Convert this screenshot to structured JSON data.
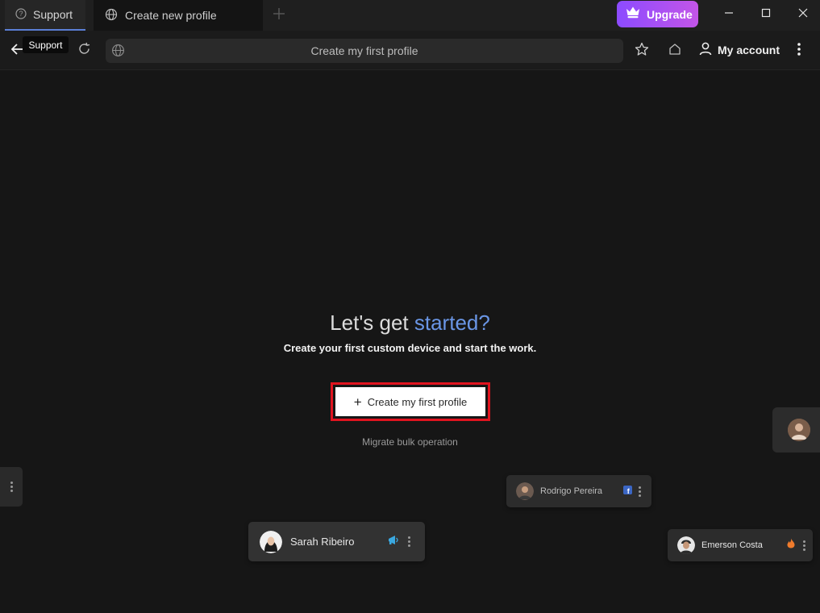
{
  "tabs": {
    "support": {
      "label": "Support",
      "icon": "help-circle-icon"
    },
    "create": {
      "label": "Create new profile",
      "icon": "globe-icon"
    },
    "new_tab_icon": "plus-icon"
  },
  "upgrade": {
    "label": "Upgrade",
    "icon": "crown-icon",
    "gradient_from": "#8c4bff",
    "gradient_to": "#c355e8"
  },
  "window_controls": [
    "minimize-icon",
    "maximize-icon",
    "close-icon"
  ],
  "toolbar": {
    "tooltip": "Support",
    "url_text": "Create my first profile",
    "account_label": "My account"
  },
  "main": {
    "headline_part1": "Let's get ",
    "headline_accent": "started?",
    "subtitle": "Create your first custom device and start the work.",
    "cta_icon": "+",
    "cta_label": "Create my first profile",
    "migrate_link": "Migrate bulk operation"
  },
  "cards": [
    {
      "name": "Rodrigo Pereira",
      "badge": "facebook-icon",
      "badge_color": "#3b66c4"
    },
    {
      "name": "Sarah Ribeiro",
      "badge": "megaphone-icon",
      "badge_color": "#3aa8e0"
    },
    {
      "name": "Emerson Costa",
      "badge": "tinder-flame-icon",
      "badge_color": "#ef7b2c"
    }
  ],
  "colors": {
    "accent": "#6a96e6",
    "highlight_border": "#e0141f",
    "background": "#161616"
  }
}
